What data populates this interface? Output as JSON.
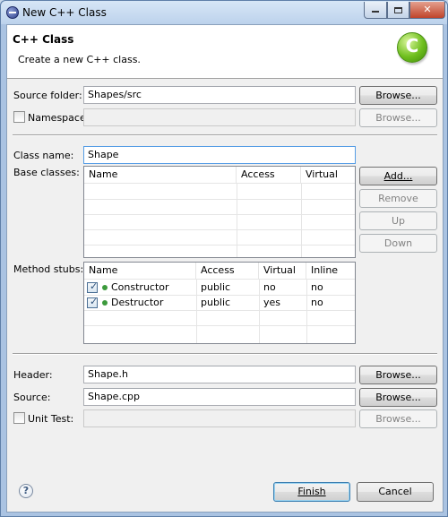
{
  "window": {
    "title": "New C++ Class"
  },
  "banner": {
    "title": "C++ Class",
    "description": "Create a new C++ class.",
    "logo_icon": "c-cpp-logo-icon"
  },
  "source_folder": {
    "label": "Source folder:",
    "value": "Shapes/src",
    "browse_label": "Browse..."
  },
  "namespace": {
    "label": "Namespace:",
    "value": "",
    "browse_label": "Browse...",
    "checked": false
  },
  "class_name": {
    "label": "Class name:",
    "value": "Shape"
  },
  "base_classes": {
    "label": "Base classes:",
    "columns": [
      "Name",
      "Access",
      "Virtual"
    ],
    "rows": []
  },
  "base_buttons": {
    "add": "Add...",
    "remove": "Remove",
    "up": "Up",
    "down": "Down"
  },
  "method_stubs": {
    "label": "Method stubs:",
    "columns": [
      "Name",
      "Access",
      "Virtual",
      "Inline"
    ],
    "rows": [
      {
        "checked": true,
        "name": "Constructor",
        "access": "public",
        "virtual": "no",
        "inline": "no"
      },
      {
        "checked": true,
        "name": "Destructor",
        "access": "public",
        "virtual": "yes",
        "inline": "no"
      }
    ]
  },
  "header": {
    "label": "Header:",
    "value": "Shape.h",
    "browse_label": "Browse..."
  },
  "source": {
    "label": "Source:",
    "value": "Shape.cpp",
    "browse_label": "Browse..."
  },
  "unit_test": {
    "label": "Unit Test:",
    "value": "",
    "browse_label": "Browse...",
    "checked": false
  },
  "footer": {
    "help_icon": "help-icon",
    "help_glyph": "?",
    "finish": "Finish",
    "cancel": "Cancel"
  }
}
